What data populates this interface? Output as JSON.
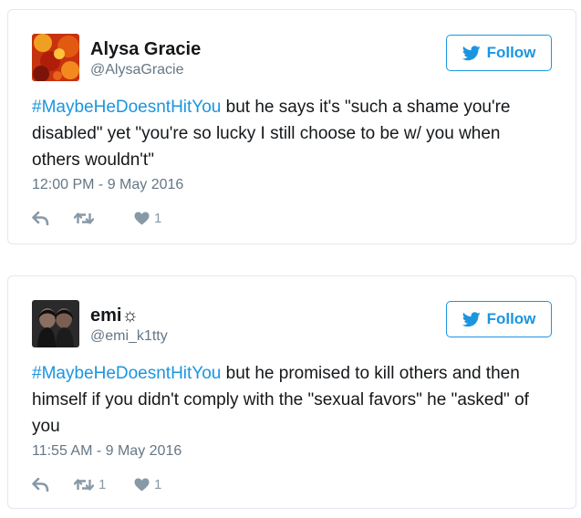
{
  "tweets": [
    {
      "name": "Alysa Gracie",
      "handle": "@AlysaGracie",
      "follow_label": "Follow",
      "hashtag": "#MaybeHeDoesntHitYou",
      "text": " but he says it's \"such a shame you're disabled\" yet \"you're so lucky I still choose to be w/ you when others wouldn't\"",
      "timestamp": "12:00 PM - 9 May 2016",
      "retweets": "",
      "likes": "1"
    },
    {
      "name": "emi☼",
      "handle": "@emi_k1tty",
      "follow_label": "Follow",
      "hashtag": "#MaybeHeDoesntHitYou",
      "text": " but he promised to kill others and then himself if you didn't comply with the \"sexual favors\" he \"asked\" of you",
      "timestamp": "11:55 AM - 9 May 2016",
      "retweets": "1",
      "likes": "1"
    }
  ],
  "colors": {
    "accent": "#1b95e0",
    "secondary_text": "#657786",
    "icon": "#8899a6",
    "border": "#e1e8ed"
  },
  "icons": {
    "follow": "twitter-bird-icon",
    "reply": "reply-icon",
    "retweet": "retweet-icon",
    "like": "heart-icon"
  }
}
